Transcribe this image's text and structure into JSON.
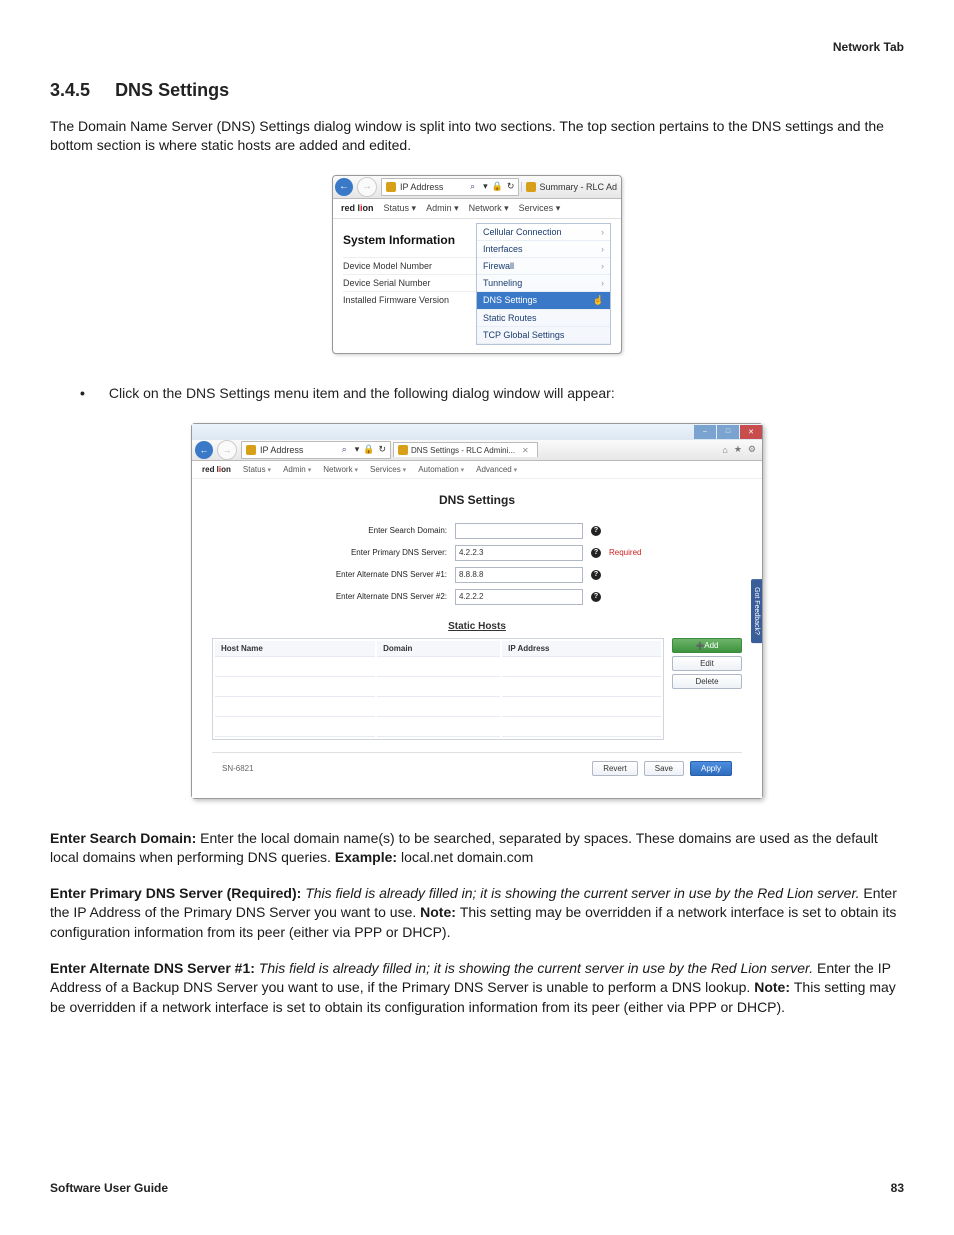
{
  "header": {
    "breadcrumb": "Network Tab"
  },
  "section": {
    "number": "3.4.5",
    "title": "DNS Settings"
  },
  "intro": "The Domain Name Server (DNS) Settings dialog window is split into two sections. The top section pertains to the DNS settings and the bottom section is where static hosts are added and edited.",
  "screenshot1": {
    "addressbar": {
      "text": "IP Address",
      "search_glyph": "⌕",
      "refresh_glyph": "↻"
    },
    "summary_tab": "Summary - RLC Ad",
    "menubar": [
      "Status",
      "Admin",
      "Network",
      "Services"
    ],
    "sysinfo_title": "System Information",
    "left_rows": [
      "Device Model Number",
      "Device Serial Number",
      "Installed Firmware Version"
    ],
    "dropdown": {
      "items": [
        {
          "label": "Cellular Connection",
          "caret": true
        },
        {
          "label": "Interfaces",
          "caret": true
        },
        {
          "label": "Firewall",
          "caret": true
        },
        {
          "label": "Tunneling",
          "caret": true
        },
        {
          "label": "DNS Settings",
          "selected": true
        },
        {
          "label": "Static Routes"
        },
        {
          "label": "TCP Global Settings"
        }
      ]
    }
  },
  "bullet1": "Click on the DNS Settings menu item and the following dialog window will appear:",
  "screenshot2": {
    "addressbar": {
      "text": "IP Address"
    },
    "tab_title": "DNS Settings - RLC Admini...",
    "menubar": [
      "Status",
      "Admin",
      "Network",
      "Services",
      "Automation",
      "Advanced"
    ],
    "page_title": "DNS Settings",
    "form": {
      "search_domain_label": "Enter Search Domain:",
      "search_domain_value": "",
      "primary_label": "Enter Primary DNS Server:",
      "primary_value": "4.2.2.3",
      "primary_required": "Required",
      "alt1_label": "Enter Alternate DNS Server #1:",
      "alt1_value": "8.8.8.8",
      "alt2_label": "Enter Alternate DNS Server #2:",
      "alt2_value": "4.2.2.2"
    },
    "feedback": "Got Feedback?",
    "static_hosts": "Static Hosts",
    "table_headers": {
      "host": "Host Name",
      "domain": "Domain",
      "ip": "IP Address"
    },
    "buttons": {
      "add": "Add",
      "edit": "Edit",
      "delete": "Delete"
    },
    "bottom": {
      "model": "SN-6821",
      "revert": "Revert",
      "save": "Save",
      "apply": "Apply"
    }
  },
  "paragraphs": {
    "p1_b1": "Enter Search Domain: ",
    "p1_t1": "Enter the local domain name(s) to be searched, separated by spaces. These domains are used as the default local domains when performing DNS queries. ",
    "p1_b2": "Example: ",
    "p1_t2": "local.net domain.com",
    "p2_b1": "Enter Primary DNS Server (Required): ",
    "p2_i1": "This field is already filled in; it is showing the current server in use by the Red Lion server. ",
    "p2_t1": "Enter the IP Address of the Primary DNS Server you want to use. ",
    "p2_b2": "Note: ",
    "p2_t2": "This setting may be overridden if a network interface is set to obtain its configuration information from its peer (either via PPP or DHCP).",
    "p3_b1": "Enter Alternate DNS Server #1: ",
    "p3_i1": "This field is already filled in; it is showing the current server in use by the Red Lion server. ",
    "p3_t1": "Enter the IP Address of a Backup DNS Server you want to use, if the Primary DNS Server is unable to perform a DNS lookup. ",
    "p3_b2": "Note: ",
    "p3_t2": "This setting may be overridden if a network interface is set to obtain its configuration information from its peer (either via PPP or DHCP)."
  },
  "footer": {
    "left": "Software User Guide",
    "right": "83"
  }
}
